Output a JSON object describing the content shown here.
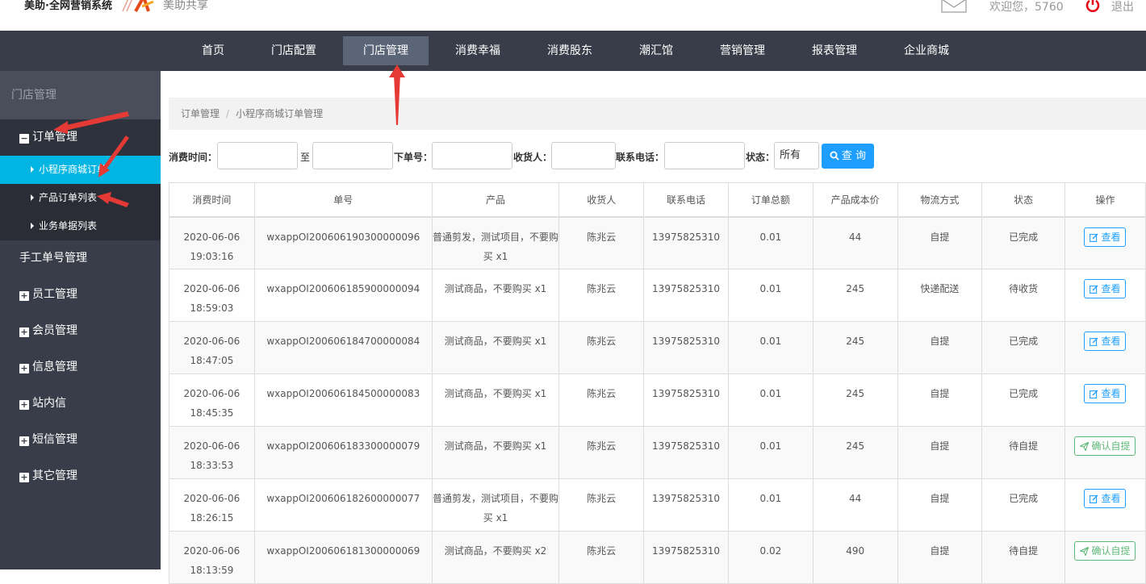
{
  "header": {
    "brand": "美助·全网营销系统",
    "brand_sub": "美助共享",
    "welcome": "欢迎您，5760",
    "logout": "退出"
  },
  "nav": {
    "items": [
      "首页",
      "门店配置",
      "门店管理",
      "消费幸福",
      "消费股东",
      "潮汇馆",
      "营销管理",
      "报表管理",
      "企业商城"
    ],
    "active_index": 2
  },
  "sidebar": {
    "heading": "门店管理",
    "order_group": "订单管理",
    "sub_items": [
      "小程序商城订单",
      "产品订单列表",
      "业务单据列表"
    ],
    "manual": "手工单号管理",
    "groups": [
      "员工管理",
      "会员管理",
      "信息管理",
      "站内信",
      "短信管理",
      "其它管理"
    ]
  },
  "breadcrumb": {
    "parent": "订单管理",
    "sep": "/",
    "current": "小程序商城订单管理"
  },
  "filters": {
    "time_label": "消费时间：",
    "to_label": "至",
    "order_label": "下单号：",
    "receiver_label": "收货人：",
    "phone_label": "联系电话：",
    "status_label": "状态：",
    "status_value": "所有",
    "query_label": "查 询"
  },
  "table": {
    "headers": [
      "消费时间",
      "单号",
      "产品",
      "收货人",
      "联系电话",
      "订单总额",
      "产品成本价",
      "物流方式",
      "状态",
      "操作"
    ],
    "rows": [
      {
        "date": "2020-06-06",
        "time": "19:03:16",
        "order": "wxappOI200606190300000096",
        "product": "普通剪发，测试项目，不要购买 x1",
        "receiver": "陈兆云",
        "phone": "13975825310",
        "total": "0.01",
        "cost": "44",
        "logistics": "自提",
        "status": "已完成",
        "action": "查看"
      },
      {
        "date": "2020-06-06",
        "time": "18:59:03",
        "order": "wxappOI200606185900000094",
        "product": "测试商品，不要购买 x1",
        "receiver": "陈兆云",
        "phone": "13975825310",
        "total": "0.01",
        "cost": "245",
        "logistics": "快递配送",
        "status": "待收货",
        "action": "查看"
      },
      {
        "date": "2020-06-06",
        "time": "18:47:05",
        "order": "wxappOI200606184700000084",
        "product": "测试商品，不要购买 x1",
        "receiver": "陈兆云",
        "phone": "13975825310",
        "total": "0.01",
        "cost": "245",
        "logistics": "自提",
        "status": "已完成",
        "action": "查看"
      },
      {
        "date": "2020-06-06",
        "time": "18:45:35",
        "order": "wxappOI200606184500000083",
        "product": "测试商品，不要购买 x1",
        "receiver": "陈兆云",
        "phone": "13975825310",
        "total": "0.01",
        "cost": "245",
        "logistics": "自提",
        "status": "已完成",
        "action": "查看"
      },
      {
        "date": "2020-06-06",
        "time": "18:33:53",
        "order": "wxappOI200606183300000079",
        "product": "测试商品，不要购买 x1",
        "receiver": "陈兆云",
        "phone": "13975825310",
        "total": "0.01",
        "cost": "245",
        "logistics": "自提",
        "status": "待自提",
        "action": "确认自提"
      },
      {
        "date": "2020-06-06",
        "time": "18:26:15",
        "order": "wxappOI200606182600000077",
        "product": "普通剪发，测试项目，不要购买 x1",
        "receiver": "陈兆云",
        "phone": "13975825310",
        "total": "0.01",
        "cost": "44",
        "logistics": "自提",
        "status": "已完成",
        "action": "查看"
      },
      {
        "date": "2020-06-06",
        "time": "18:13:59",
        "order": "wxappOI200606181300000069",
        "product": "测试商品，不要购买 x2",
        "receiver": "陈兆云",
        "phone": "13975825310",
        "total": "0.02",
        "cost": "490",
        "logistics": "自提",
        "status": "待自提",
        "action": "确认自提"
      }
    ]
  },
  "colors": {
    "nav_bg": "#393d49",
    "active_sub": "#00b5e2",
    "primary": "#1e9fff",
    "confirm": "#5fb878",
    "annotation_arrow": "#e53935"
  }
}
